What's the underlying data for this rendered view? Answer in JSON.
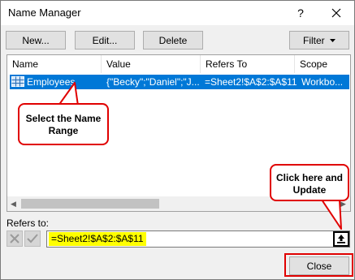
{
  "window": {
    "title": "Name Manager",
    "help_glyph": "?"
  },
  "toolbar": {
    "new_label": "New...",
    "edit_label": "Edit...",
    "delete_label": "Delete",
    "filter_label": "Filter"
  },
  "list": {
    "columns": [
      "Name",
      "Value",
      "Refers To",
      "Scope"
    ],
    "rows": [
      {
        "name": "Employees",
        "value": "{\"Becky\";\"Daniel\";\"J...",
        "refers_to": "=Sheet2!$A$2:$A$11",
        "scope": "Workbo..."
      }
    ]
  },
  "refers_to": {
    "label": "Refers to:",
    "value": "=Sheet2!$A$2:$A$11"
  },
  "close_label": "Close",
  "annotations": {
    "select_range": "Select the Name Range",
    "click_update": "Click here and Update"
  },
  "colors": {
    "selection": "#0078d7",
    "highlight": "#ffff00",
    "annotation": "#e00000"
  },
  "icons": {
    "row_icon": "table-grid-icon",
    "collapse": "collapse-dialog-icon"
  }
}
